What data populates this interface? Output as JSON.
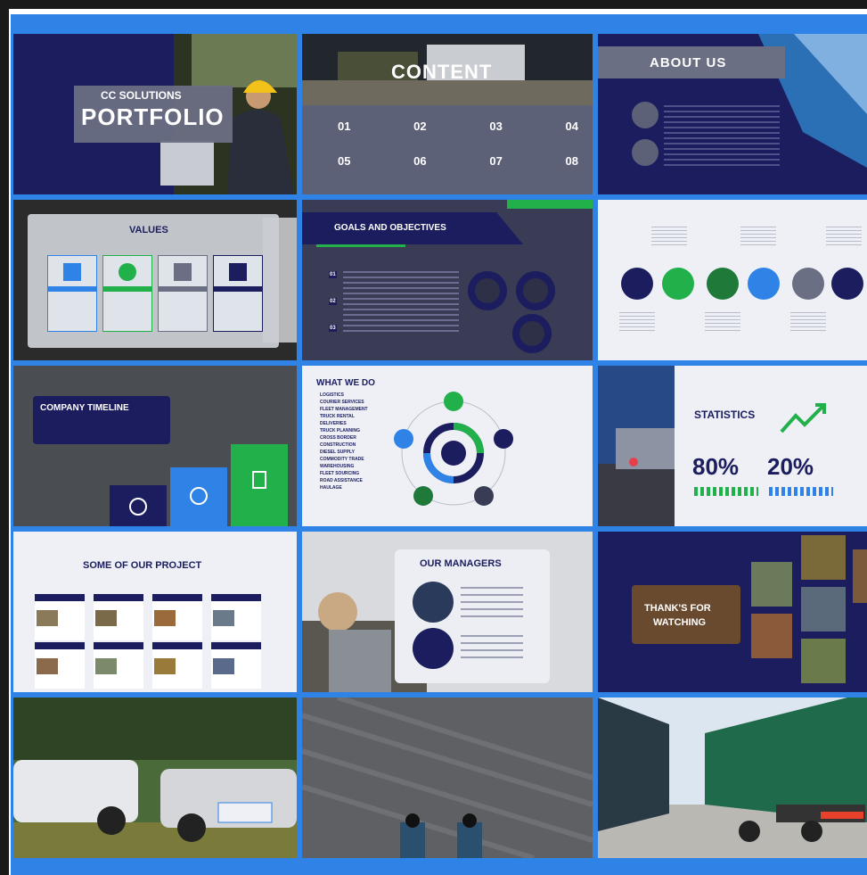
{
  "colors": {
    "navy": "#1c1d5e",
    "blue": "#2f82e6",
    "green": "#22b04b",
    "slate": "#5c6177",
    "light": "#eef0f6"
  },
  "slides": {
    "cover": {
      "brand": "CC SOLUTIONS",
      "title": "PORTFOLIO"
    },
    "content": {
      "title": "CONTENT",
      "items": [
        "01",
        "02",
        "03",
        "04",
        "05",
        "06",
        "07",
        "08"
      ]
    },
    "about": {
      "title": "ABOUT US"
    },
    "values": {
      "title": "VALUES"
    },
    "goals": {
      "title": "GOALS AND OBJECTIVES",
      "items": [
        "01",
        "02",
        "03"
      ]
    },
    "timeline": {
      "title": "COMPANY TIMELINE"
    },
    "whatwedo": {
      "title": "WHAT WE DO",
      "list": [
        "LOGISTICS",
        "COURIER SERVICES",
        "FLEET MANAGEMENT",
        "TRUCK RENTAL",
        "DELIVERIES",
        "TRUCK PLANNING",
        "CROSS BORDER",
        "CONSTRUCTION",
        "DIESEL SUPPLY",
        "COMMODITY TRADE",
        "WAREHOUSING",
        "FLEET SOURCING",
        "ROAD ASSISTANCE",
        "HAULAGE"
      ]
    },
    "statistics": {
      "title": "STATISTICS",
      "stat1": "80%",
      "stat2": "20%"
    },
    "projects": {
      "title": "SOME OF OUR PROJECT"
    },
    "managers": {
      "title": "OUR MANAGERS"
    },
    "thanks": {
      "line1": "THANK'S FOR",
      "line2": "WATCHING"
    }
  }
}
